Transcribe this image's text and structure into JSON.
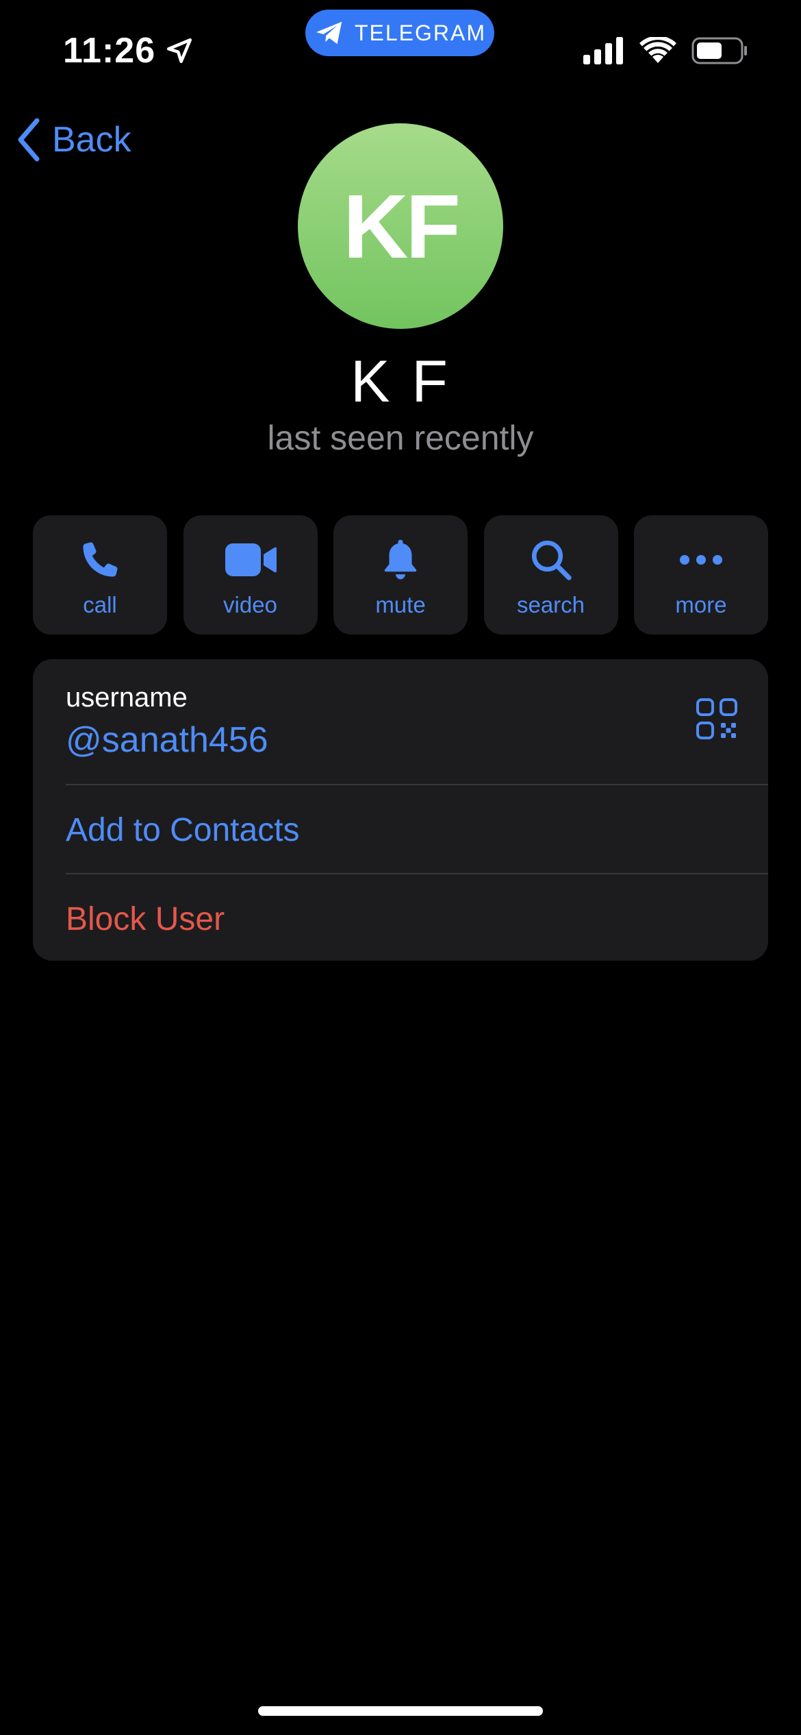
{
  "status_bar": {
    "time": "11:26",
    "app_pill_label": "TELEGRAM"
  },
  "nav": {
    "back_label": "Back"
  },
  "profile": {
    "avatar_initials": "KF",
    "name": "K F",
    "status": "last seen recently",
    "avatar_colors": [
      "#a6db8a",
      "#72c45f"
    ]
  },
  "actions": [
    {
      "label": "call",
      "icon": "phone-icon"
    },
    {
      "label": "video",
      "icon": "video-camera-icon"
    },
    {
      "label": "mute",
      "icon": "bell-icon"
    },
    {
      "label": "search",
      "icon": "search-icon"
    },
    {
      "label": "more",
      "icon": "more-dots-icon"
    }
  ],
  "info": {
    "username_label": "username",
    "username_value": "@sanath456",
    "add_contacts_label": "Add to Contacts",
    "block_user_label": "Block User"
  },
  "colors": {
    "accent": "#4f8cf7",
    "destructive": "#e4584b",
    "card_background": "#1c1c1e",
    "pill": "#3478f6"
  }
}
